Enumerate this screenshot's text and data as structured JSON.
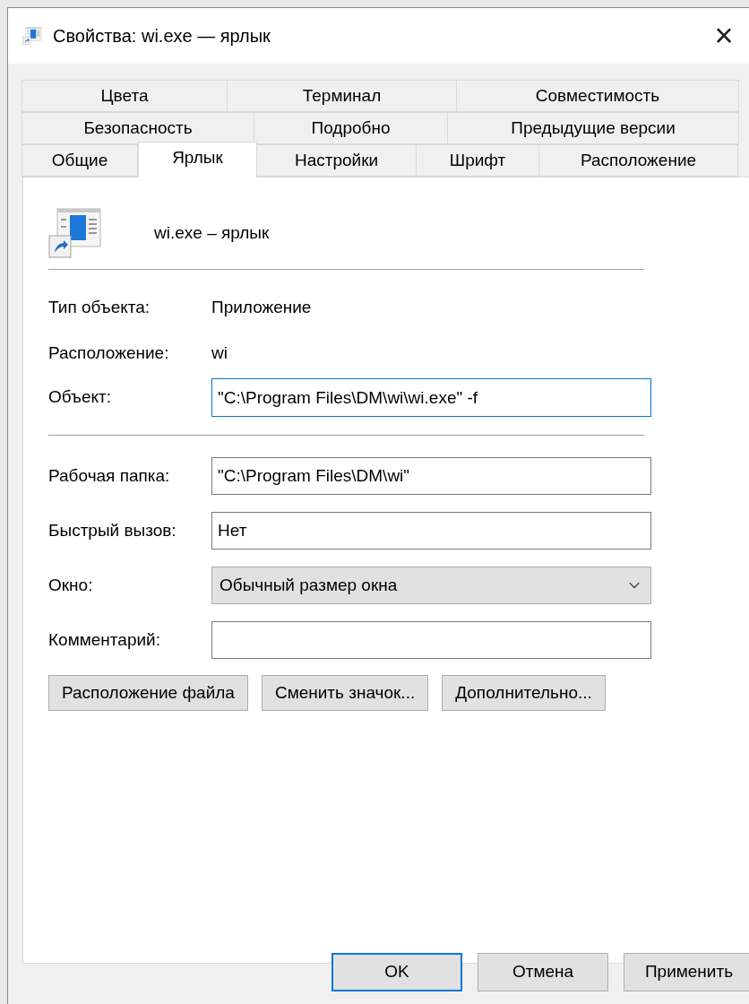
{
  "window": {
    "title": "Свойства: wi.exe — ярлык",
    "close": "×"
  },
  "tab_rows": [
    [
      {
        "label": "Цвета",
        "selected": false
      },
      {
        "label": "Терминал",
        "selected": false
      },
      {
        "label": "Совместимость",
        "selected": false
      }
    ],
    [
      {
        "label": "Безопасность",
        "selected": false
      },
      {
        "label": "Подробно",
        "selected": false
      },
      {
        "label": "Предыдущие версии",
        "selected": false
      }
    ],
    [
      {
        "label": "Общие",
        "selected": false
      },
      {
        "label": "Ярлык",
        "selected": true
      },
      {
        "label": "Настройки",
        "selected": false
      },
      {
        "label": "Шрифт",
        "selected": false
      },
      {
        "label": "Расположение",
        "selected": false
      }
    ]
  ],
  "shortcut_name": "wi.exe – ярлык",
  "info": [
    {
      "label": "Тип объекта:",
      "value": "Приложение"
    },
    {
      "label": "Расположение:",
      "value": "wi"
    }
  ],
  "target": {
    "label": "Объект:",
    "value": "\"C:\\Program Files\\DM\\wi\\wi.exe\" -f",
    "focused": true
  },
  "fields": [
    {
      "kind": "text",
      "label": "Рабочая папка:",
      "value": "\"C:\\Program Files\\DM\\wi\""
    },
    {
      "kind": "text",
      "label": "Быстрый вызов:",
      "value": "Нет"
    },
    {
      "kind": "dropdown",
      "label": "Окно:",
      "value": "Обычный размер окна"
    },
    {
      "kind": "text",
      "label": "Комментарий:"
    }
  ],
  "actions": [
    "Расположение файла",
    "Сменить значок...",
    "Дополнительно..."
  ],
  "buttons": [
    {
      "label": "OK",
      "default": true
    },
    {
      "label": "Отмена",
      "default": false
    },
    {
      "label": "Применить",
      "default": false
    }
  ]
}
